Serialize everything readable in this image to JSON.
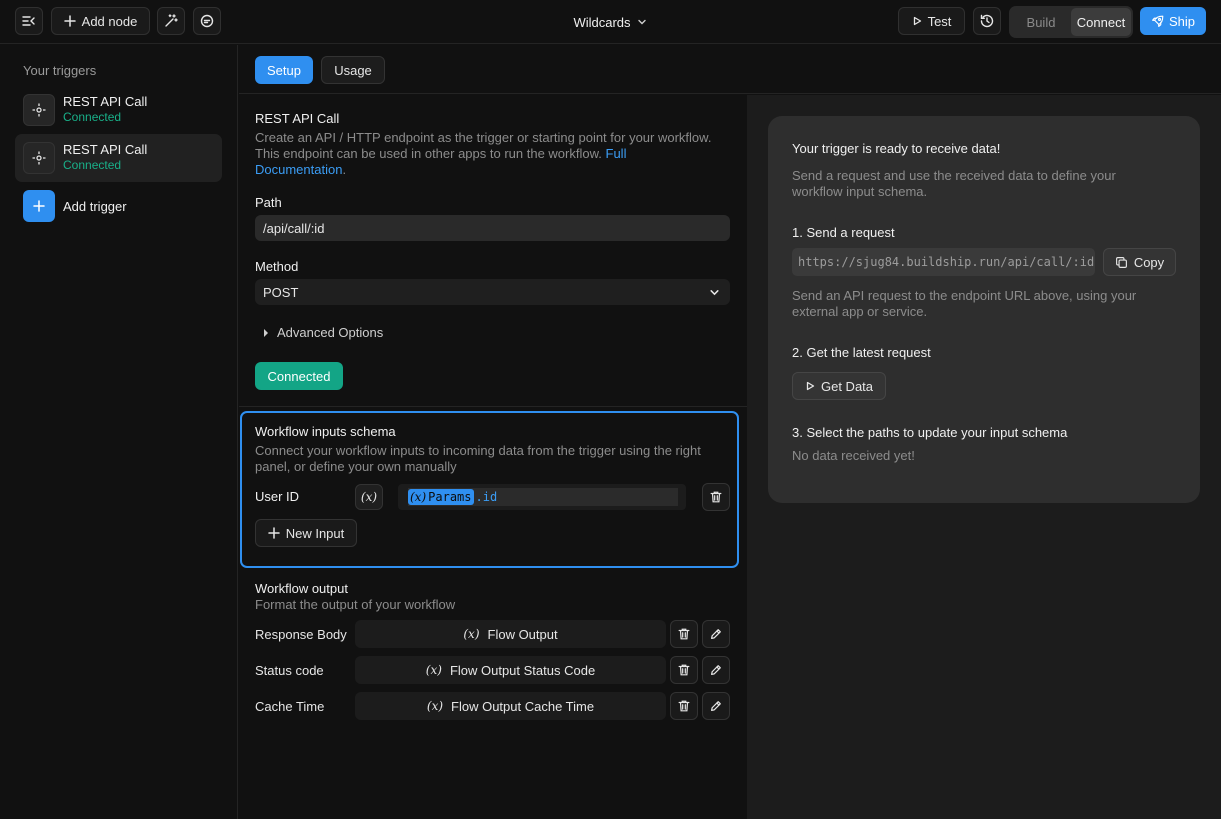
{
  "topbar": {
    "add_node_label": "Add node",
    "title": "Wildcards",
    "test_label": "Test",
    "build_label": "Build",
    "connect_label": "Connect",
    "ship_label": "Ship"
  },
  "sidebar": {
    "heading": "Your triggers",
    "triggers": [
      {
        "name": "REST API Call",
        "status": "Connected"
      },
      {
        "name": "REST API Call",
        "status": "Connected"
      }
    ],
    "add_trigger_label": "Add trigger"
  },
  "tabs": {
    "setup": "Setup",
    "usage": "Usage"
  },
  "setup": {
    "title": "REST API Call",
    "description_1": "Create an API / HTTP endpoint as the trigger or starting point for your workflow.",
    "description_2": "This endpoint can be used in other apps to run the workflow.",
    "doc_link_1": "Full",
    "doc_link_2": "Documentation",
    "doc_tail": ".",
    "path_label": "Path",
    "path_value": "/api/call/:id",
    "method_label": "Method",
    "method_value": "POST",
    "advanced_label": "Advanced Options",
    "connected_label": "Connected"
  },
  "schema": {
    "title": "Workflow inputs schema",
    "description_1": "Connect your workflow inputs to incoming data from the trigger using the right",
    "description_2": "panel, or define your own manually",
    "input_label": "User ID",
    "var_symbol": "(x)",
    "chip_label": "Params",
    "chip_prop": ".id",
    "new_input_label": "New Input"
  },
  "output": {
    "title": "Workflow output",
    "description": "Format the output of your workflow",
    "rows": [
      {
        "label": "Response Body",
        "value": "Flow Output"
      },
      {
        "label": "Status code",
        "value": "Flow Output Status Code"
      },
      {
        "label": "Cache Time",
        "value": "Flow Output Cache Time"
      }
    ]
  },
  "right": {
    "ready_title": "Your trigger is ready to receive data!",
    "ready_desc_1": "Send a request and use the received data to define your",
    "ready_desc_2": "workflow input schema.",
    "step1": "1. Send a request",
    "url": "https://sjug84.buildship.run/api/call/:id",
    "copy_label": "Copy",
    "step1_desc_1": "Send an API request to the endpoint URL above, using your",
    "step1_desc_2": "external app or service.",
    "step2": "2. Get the latest request",
    "get_data_label": "Get Data",
    "step3": "3. Select the paths to update your input schema",
    "no_data": "No data received yet!"
  }
}
